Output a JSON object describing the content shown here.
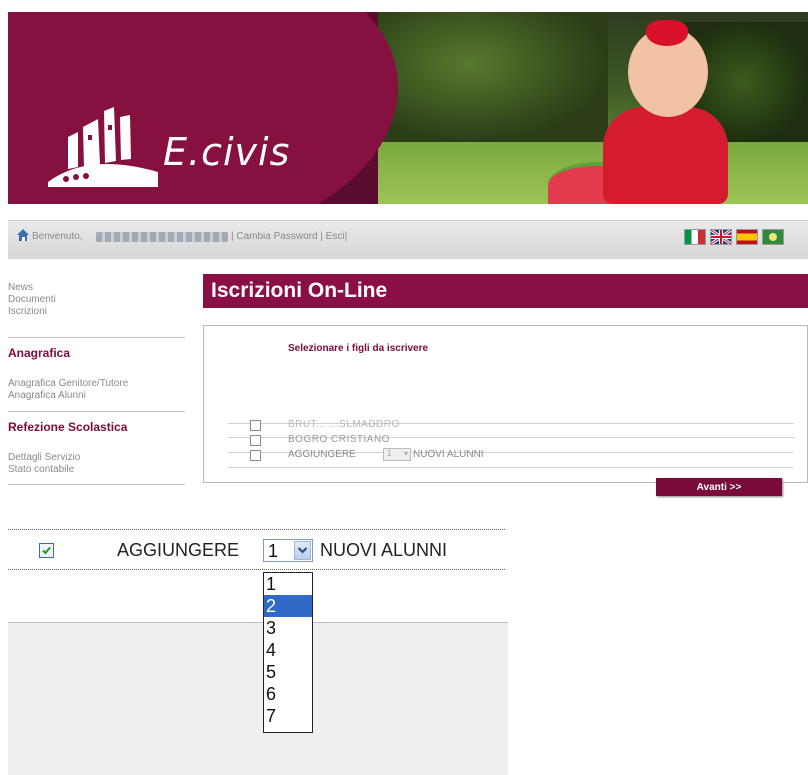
{
  "banner": {
    "logo_text": "E.civis"
  },
  "topbar": {
    "welcome": "Benvenuto,",
    "change_password": "| Cambia Password  | Esci|",
    "flags": [
      "italian-flag-icon",
      "uk-flag-icon",
      "spanish-flag-icon",
      "other-flag-icon"
    ]
  },
  "nav": {
    "links_top": [
      "News",
      "Documenti",
      "Iscrizioni"
    ],
    "section1": {
      "title": "Anagrafica",
      "items": [
        "Anagrafica Genitore/Tutore",
        "Anagrafica Alunni"
      ]
    },
    "section2": {
      "title": "Refezione Scolastica",
      "items": [
        "Dettagli Servizio",
        "Stato contabile"
      ]
    }
  },
  "main": {
    "title": "Iscrizioni On-Line",
    "prompt": "Selezionare i figli da iscrivere",
    "rows": [
      {
        "name": "BRUT... ...SLMADDRO"
      },
      {
        "name": "BOGRO CRISTIANO"
      }
    ],
    "add_prefix": "AGGIUNGERE",
    "add_select_value": "1",
    "add_suffix": "NUOVI ALUNNI",
    "next_button": "Avanti >>"
  },
  "zoom": {
    "prefix": "AGGIUNGERE",
    "select_value": "1",
    "suffix": "NUOVI ALUNNI",
    "options": [
      "1",
      "2",
      "3",
      "4",
      "5",
      "6",
      "7"
    ],
    "highlighted_option": "2"
  },
  "colors": {
    "brand": "#8a0f45",
    "highlight": "#3169c6"
  }
}
